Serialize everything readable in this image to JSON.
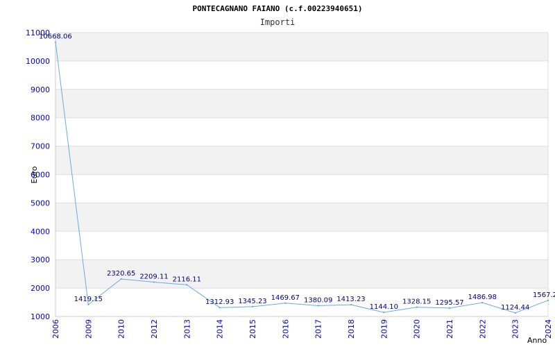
{
  "chart_data": {
    "type": "line",
    "title": "PONTECAGNANO FAIANO (c.f.00223940651)",
    "subtitle": "Importi",
    "xlabel": "Anno",
    "ylabel": "Euro",
    "categories": [
      "2006",
      "2009",
      "2010",
      "2012",
      "2013",
      "2014",
      "2015",
      "2016",
      "2017",
      "2018",
      "2019",
      "2020",
      "2021",
      "2022",
      "2023",
      "2024"
    ],
    "series": [
      {
        "values": [
          10668.06,
          1419.15,
          2320.65,
          2209.11,
          2116.11,
          1312.93,
          1345.23,
          1469.67,
          1380.09,
          1413.23,
          1144.1,
          1328.15,
          1295.57,
          1486.98,
          1124.44,
          1567.2
        ],
        "labels": [
          "10668.06",
          "1419.15",
          "2320.65",
          "2209.11",
          "2116.11",
          "1312.93",
          "1345.23",
          "1469.67",
          "1380.09",
          "1413.23",
          "1144.10",
          "1328.15",
          "1295.57",
          "1486.98",
          "1124.44",
          "1567.2"
        ]
      }
    ],
    "ylim": [
      1000,
      11000
    ],
    "yticks": [
      "1000",
      "2000",
      "3000",
      "4000",
      "5000",
      "6000",
      "7000",
      "8000",
      "9000",
      "10000",
      "11000"
    ],
    "grid": true,
    "colors": {
      "line": "#66aaee",
      "band": "#f2f2f2",
      "grid": "#dddddd",
      "tick_text": "#0000cc",
      "label_text": "#000080"
    }
  }
}
